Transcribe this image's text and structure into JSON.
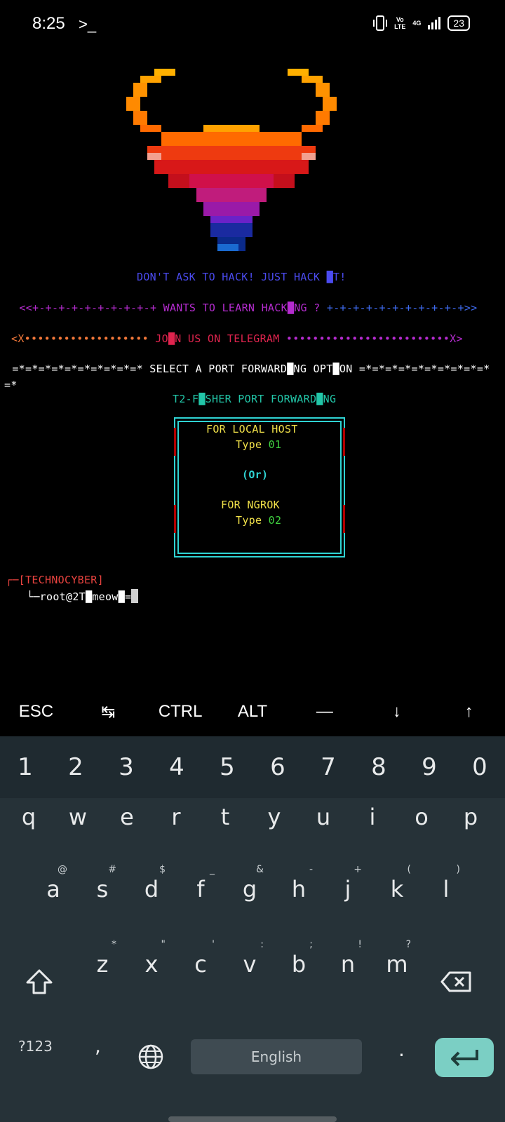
{
  "status_bar": {
    "time": "8:25",
    "prompt_icon": ">_",
    "volte": "Vo\nLTE",
    "network": "4G",
    "battery": "23"
  },
  "terminal": {
    "tagline": "DON'T ASK TO HACK! JUST HACK █T!",
    "learn_line_left": " <<+-+-+-+-+-+-+-+-+-+ ",
    "learn_line_mid": "WANTS TO LEARN HACK█NG ?",
    "learn_line_right": " +-+-+-+-+-+-+-+-+-+-+>>",
    "telegram_left": "<X••••••••••••••••••• ",
    "telegram_mid": "JO█N US ON TELEGRAM",
    "telegram_right": " •••••••••••••••••••••••••X>",
    "select_line": " =*=*=*=*=*=*=*=*=*=* SELECT A PORT FORWARD█NG OPT█ON =*=*=*=*=*=*=*=*=*=*",
    "select_wrap": "=*",
    "t2_title": "T2-F█SHER PORT FORWARD█NG",
    "box": {
      "local_label": "FOR LOCAL HOST",
      "type_word_1": "Type ",
      "local_code": "01",
      "or_text": "(Or)",
      "ngrok_label": "FOR NGROK",
      "type_word_2": "Type ",
      "ngrok_code": "02"
    },
    "prompt_prefix": "┌─",
    "prompt_name": "[TECHNOCYBER]",
    "prompt_arrow": "└─",
    "prompt_user": "root@2T█meow█=",
    "colors": {
      "tagline": "#4b4bf0",
      "magenta": "#b52ccf",
      "blue": "#3f6cf2",
      "orange": "#f2783a",
      "red": "#e0244e",
      "teal": "#22c6a8",
      "yellow": "#f2e24a",
      "green": "#3fd03f",
      "cyan": "#2fd3d3",
      "prompt_red": "#e8433f"
    }
  },
  "extra_keys": [
    "ESC",
    "↹",
    "CTRL",
    "ALT",
    "—",
    "↓",
    "↑"
  ],
  "keyboard": {
    "numbers": [
      "1",
      "2",
      "3",
      "4",
      "5",
      "6",
      "7",
      "8",
      "9",
      "0"
    ],
    "row1": [
      "q",
      "w",
      "e",
      "r",
      "t",
      "y",
      "u",
      "i",
      "o",
      "p"
    ],
    "row2": [
      {
        "k": "a",
        "h": "@"
      },
      {
        "k": "s",
        "h": "#"
      },
      {
        "k": "d",
        "h": "$"
      },
      {
        "k": "f",
        "h": "_"
      },
      {
        "k": "g",
        "h": "&"
      },
      {
        "k": "h",
        "h": "-"
      },
      {
        "k": "j",
        "h": "+"
      },
      {
        "k": "k",
        "h": "("
      },
      {
        "k": "l",
        "h": ")"
      }
    ],
    "row3": [
      {
        "k": "z",
        "h": "*"
      },
      {
        "k": "x",
        "h": "\""
      },
      {
        "k": "c",
        "h": "'"
      },
      {
        "k": "v",
        "h": ":"
      },
      {
        "k": "b",
        "h": ";"
      },
      {
        "k": "n",
        "h": "!"
      },
      {
        "k": "m",
        "h": "?"
      }
    ],
    "symbols_label": "?123",
    "comma": ",",
    "space_label": "English",
    "period": "."
  }
}
